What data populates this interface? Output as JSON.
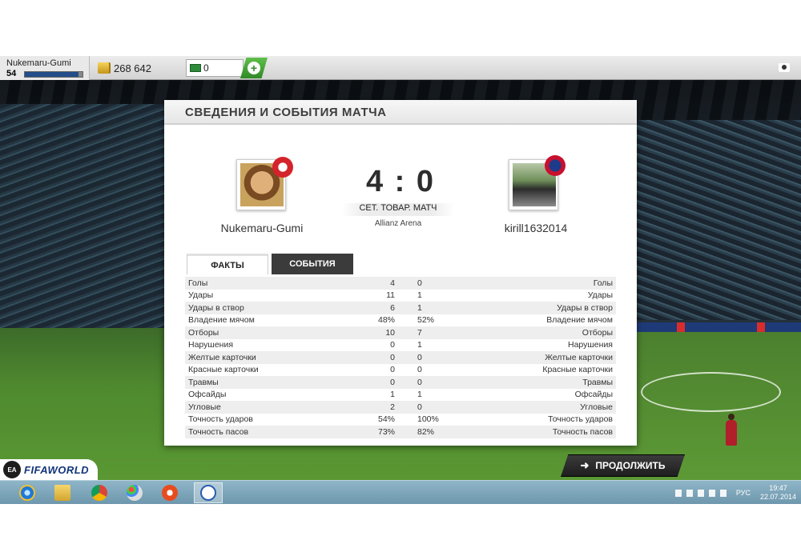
{
  "profile": {
    "name": "Nukemaru-Gumi",
    "level": "54",
    "xp_progress": 0.93
  },
  "currency": {
    "coins": "268 642",
    "points": "0"
  },
  "panel": {
    "title": "СВЕДЕНИЯ И СОБЫТИЯ МАТЧА",
    "home_name": "Nukemaru-Gumi",
    "away_name": "kirill1632014",
    "score": "4 : 0",
    "match_type": "СЕТ. ТОВАР. МАТЧ",
    "venue": "Allianz Arena",
    "tabs": {
      "facts": "ФАКТЫ",
      "events": "СОБЫТИЯ"
    }
  },
  "stats": [
    {
      "label": "Голы",
      "home": "4",
      "away": "0"
    },
    {
      "label": "Удары",
      "home": "11",
      "away": "1"
    },
    {
      "label": "Удары в створ",
      "home": "6",
      "away": "1"
    },
    {
      "label": "Владение мячом",
      "home": "48%",
      "away": "52%"
    },
    {
      "label": "Отборы",
      "home": "10",
      "away": "7"
    },
    {
      "label": "Нарушения",
      "home": "0",
      "away": "1"
    },
    {
      "label": "Желтые карточки",
      "home": "0",
      "away": "0"
    },
    {
      "label": "Красные карточки",
      "home": "0",
      "away": "0"
    },
    {
      "label": "Травмы",
      "home": "0",
      "away": "0"
    },
    {
      "label": "Офсайды",
      "home": "1",
      "away": "1"
    },
    {
      "label": "Угловые",
      "home": "2",
      "away": "0"
    },
    {
      "label": "Точность ударов",
      "home": "54%",
      "away": "100%"
    },
    {
      "label": "Точность пасов",
      "home": "73%",
      "away": "82%"
    }
  ],
  "continue_label": "ПРОДОЛЖИТЬ",
  "logo": {
    "ea": "EA SPORTS",
    "text": "FIFAWORLD"
  },
  "taskbar": {
    "lang": "РУС",
    "time": "19:47",
    "date": "22.07.2014"
  },
  "colors": {
    "accent_dark": "#1e1e1e",
    "xp_bar": "#234e8a",
    "home_badge": "#d4232a",
    "away_badge": "#c8102e"
  }
}
